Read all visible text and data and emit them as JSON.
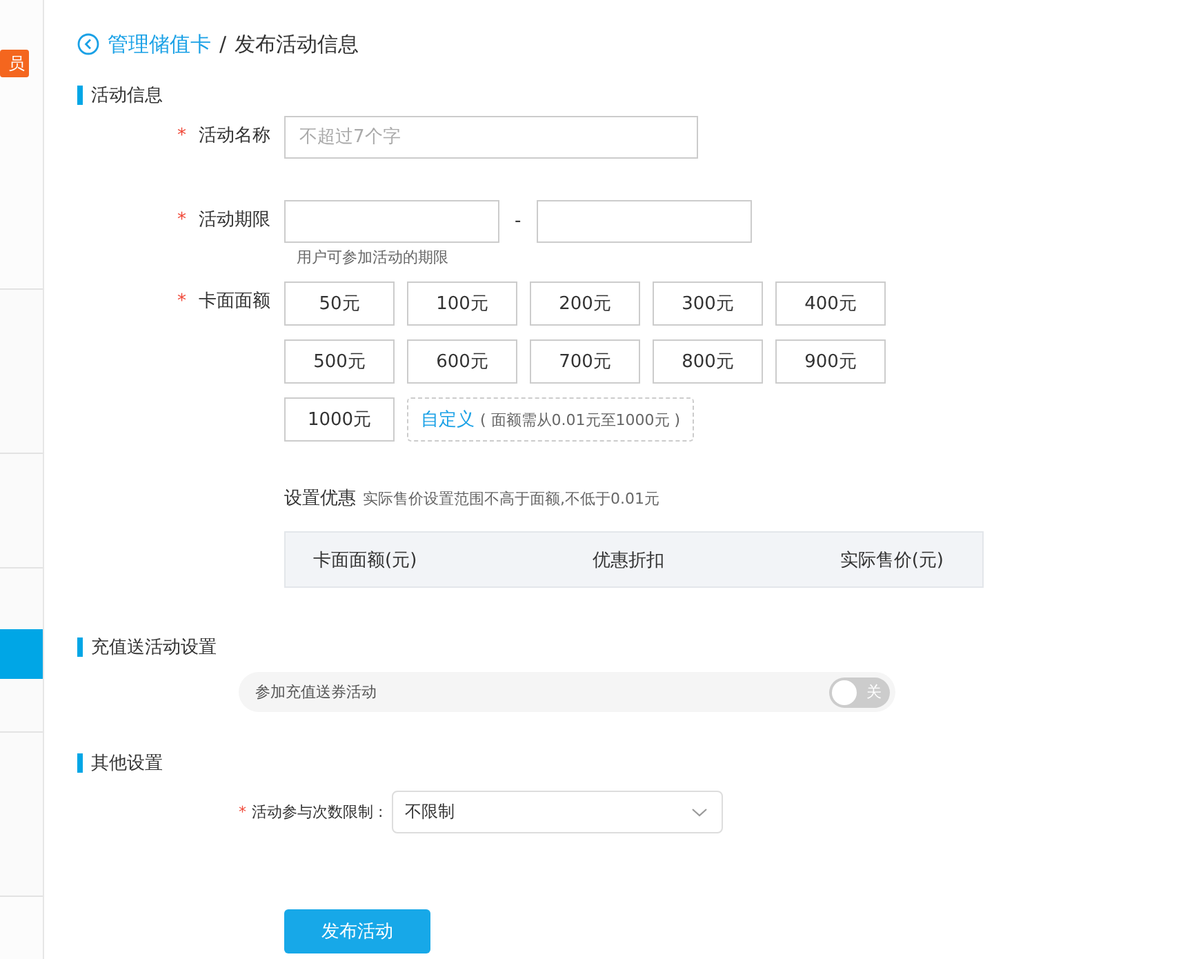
{
  "sidebar": {
    "badge": "员",
    "groups": [
      {
        "selected": false
      },
      {
        "selected": false
      },
      {
        "selected": true
      },
      {
        "selected": false
      }
    ]
  },
  "breadcrumb": {
    "back": "管理储值卡",
    "separator": "/",
    "current": "发布活动信息"
  },
  "sections": [
    {
      "title": "活动信息"
    },
    {
      "title": "充值送活动设置"
    },
    {
      "title": "其他设置"
    }
  ],
  "activity_name": {
    "label": "活动名称",
    "required_mark": "*",
    "placeholder": "不超过7个字"
  },
  "activity_period": {
    "label": "活动期限",
    "required_mark": "*",
    "separator": "-",
    "hint": "用户可参加活动的期限"
  },
  "face_value": {
    "label": "卡面面额",
    "required_mark": "*",
    "options": [
      {
        "label": "50元",
        "selected": false
      },
      {
        "label": "100元",
        "selected": false
      },
      {
        "label": "200元",
        "selected": false
      },
      {
        "label": "300元",
        "selected": false
      },
      {
        "label": "400元",
        "selected": false
      },
      {
        "label": "500元",
        "selected": false
      },
      {
        "label": "600元",
        "selected": false
      },
      {
        "label": "700元",
        "selected": false
      },
      {
        "label": "800元",
        "selected": false
      },
      {
        "label": "900元",
        "selected": false
      },
      {
        "label": "1000元",
        "selected": false
      }
    ],
    "custom": {
      "label": "自定义",
      "note": "( 面额需从0.01元至1000元 )"
    }
  },
  "discount": {
    "title": "设置优惠",
    "note": "实际售价设置范围不高于面额,不低于0.01元",
    "columns": [
      "卡面面额(元)",
      "优惠折扣",
      "实际售价(元)"
    ]
  },
  "recharge_gift": {
    "label": "参加充值送券活动",
    "on": false,
    "toggle_text": "关"
  },
  "limit": {
    "label": "活动参与次数限制 :",
    "required_mark": "*",
    "value": "不限制"
  },
  "submit": "发布活动"
}
